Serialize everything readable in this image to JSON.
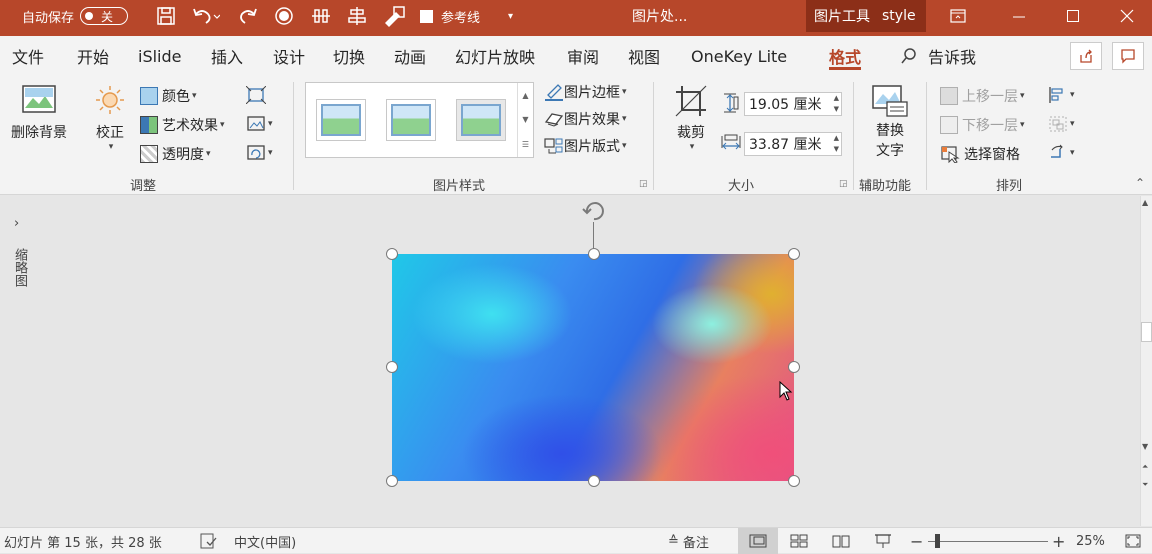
{
  "titlebar": {
    "autosave_label": "自动保存",
    "autosave_state": "关",
    "gridlines_label": "参考线",
    "doc_title": "图片处...",
    "context_tab": "图片工具",
    "user": "style"
  },
  "tabs": [
    {
      "label": "文件"
    },
    {
      "label": "开始"
    },
    {
      "label": "iSlide"
    },
    {
      "label": "插入"
    },
    {
      "label": "设计"
    },
    {
      "label": "切换"
    },
    {
      "label": "动画"
    },
    {
      "label": "幻灯片放映"
    },
    {
      "label": "审阅"
    },
    {
      "label": "视图"
    },
    {
      "label": "OneKey Lite"
    },
    {
      "label": "格式"
    }
  ],
  "tell_me": "告诉我",
  "ribbon": {
    "remove_bg": "删除背景",
    "corrections": "校正",
    "color": "颜色",
    "artistic": "艺术效果",
    "transparency": "透明度",
    "adjust_label": "调整",
    "picture_border": "图片边框",
    "picture_effects": "图片效果",
    "picture_layout": "图片版式",
    "styles_label": "图片样式",
    "crop": "裁剪",
    "height": "19.05 厘米",
    "width": "33.87 厘米",
    "size_label": "大小",
    "alt_text_1": "替换",
    "alt_text_2": "文字",
    "accessibility_label": "辅助功能",
    "bring_forward": "上移一层",
    "send_backward": "下移一层",
    "selection_pane": "选择窗格",
    "arrange_label": "排列"
  },
  "sidebar": {
    "thumbnails": "缩略图"
  },
  "status": {
    "slide_info": "幻灯片 第 15 张，共 28 张",
    "language": "中文(中国)",
    "notes": "备注",
    "zoom": "25%"
  },
  "colors": {
    "accent": "#b7472a"
  }
}
